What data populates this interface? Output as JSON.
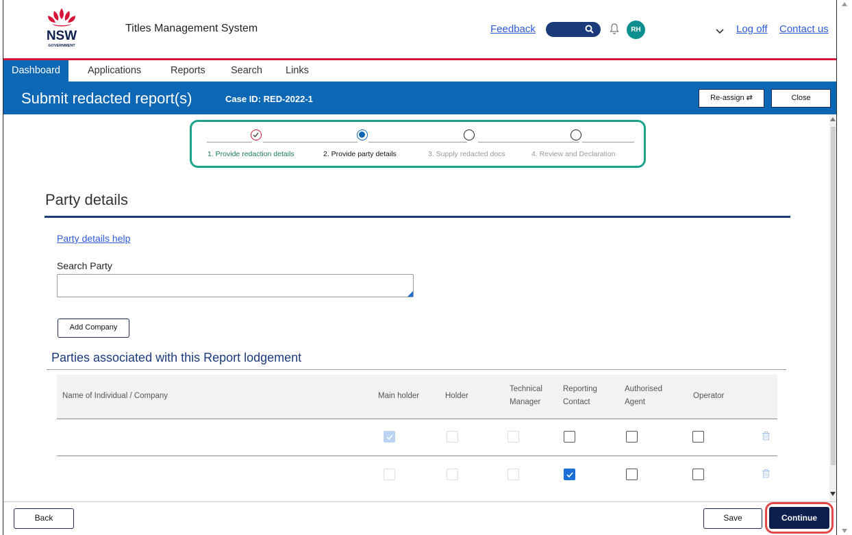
{
  "header": {
    "logo_text": "NSW",
    "logo_subtext": "GOVERNMENT",
    "app_title": "Titles Management System",
    "feedback_label": "Feedback",
    "avatar_initials": "RH",
    "logoff_label": "Log off",
    "contact_label": "Contact us"
  },
  "nav": {
    "items": [
      {
        "label": "Dashboard",
        "active": true
      },
      {
        "label": "Applications"
      },
      {
        "label": "Reports"
      },
      {
        "label": "Search"
      },
      {
        "label": "Links"
      }
    ]
  },
  "titlebar": {
    "title": "Submit redacted report(s)",
    "case_id": "Case ID: RED-2022-1",
    "reassign_label": "Re-assign ⇄",
    "close_label": "Close"
  },
  "stepper": {
    "steps": [
      {
        "label": "1. Provide redaction details",
        "status": "completed"
      },
      {
        "label": "2. Provide party details",
        "status": "current"
      },
      {
        "label": "3. Supply redacted docs",
        "status": "upcoming"
      },
      {
        "label": "4. Review and Declaration",
        "status": "upcoming"
      }
    ]
  },
  "party": {
    "title": "Party details",
    "help_link": "Party details help",
    "search_label": "Search Party",
    "search_value": "",
    "add_company_label": "Add Company",
    "section_title": "Parties associated with this Report lodgement"
  },
  "table": {
    "headers": {
      "name": "Name of Individual / Company",
      "main_holder": "Main holder",
      "holder": "Holder",
      "technical_manager_1": "Technical",
      "technical_manager_2": "Manager",
      "reporting_contact_1": "Reporting",
      "reporting_contact_2": "Contact",
      "authorised_agent_1": "Authorised",
      "authorised_agent_2": "Agent",
      "operator": "Operator"
    },
    "rows": [
      {
        "name": "",
        "main_holder": "checked-disabled",
        "holder": "disabled",
        "technical_manager": "disabled",
        "reporting_contact": "unchecked",
        "authorised_agent": "unchecked",
        "operator": "unchecked"
      },
      {
        "name": "",
        "main_holder": "disabled",
        "holder": "disabled",
        "technical_manager": "disabled",
        "reporting_contact": "checked",
        "authorised_agent": "unchecked",
        "operator": "unchecked"
      }
    ]
  },
  "footer": {
    "back_label": "Back",
    "save_label": "Save",
    "continue_label": "Continue"
  },
  "colors": {
    "brand_blue": "#0c67b5",
    "navy": "#0e1f4d",
    "nsw_red": "#d7153a",
    "stepper_highlight": "#1aa38a",
    "continue_highlight": "#e24848"
  }
}
